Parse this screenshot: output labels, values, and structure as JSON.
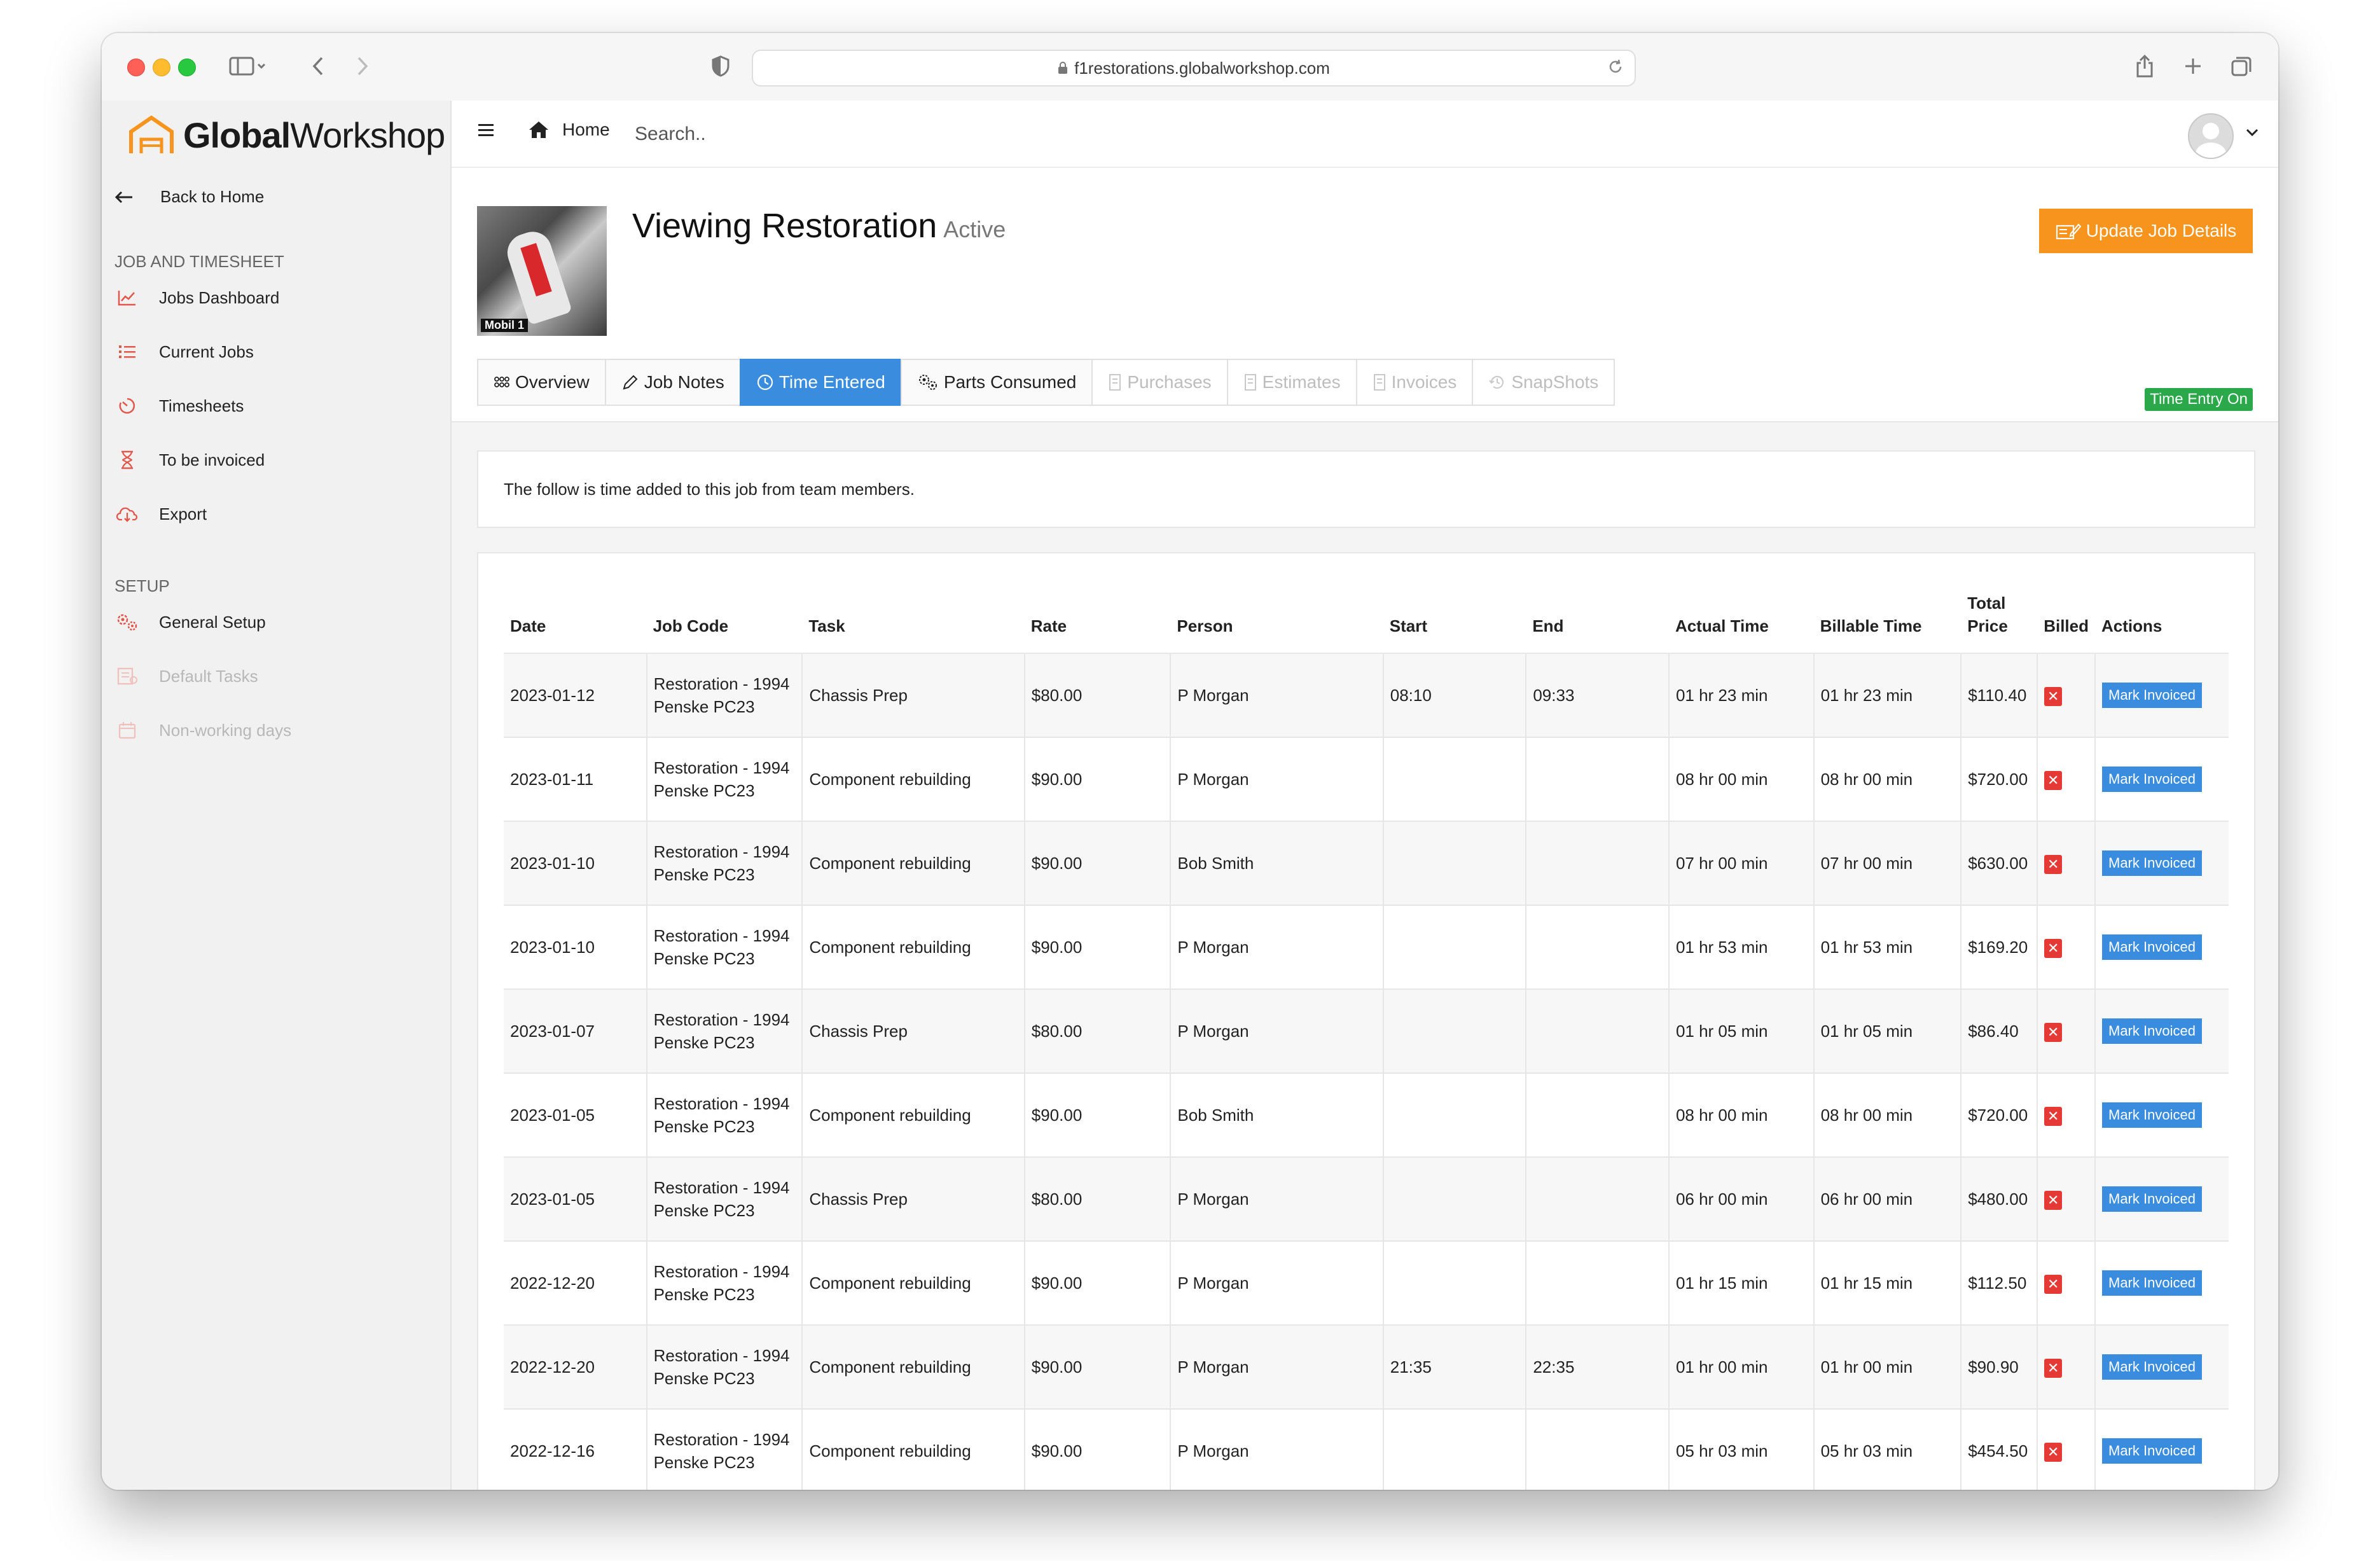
{
  "browser": {
    "url": "f1restorations.globalworkshop.com"
  },
  "brand": {
    "logo_bold": "Global",
    "logo_light": "Workshop",
    "accent_color": "#f7941d"
  },
  "sidebar": {
    "back_label": "Back to Home",
    "section_jobs": "JOB AND TIMESHEET",
    "section_setup": "SETUP",
    "items": [
      {
        "label": "Jobs Dashboard",
        "icon": "chart-icon"
      },
      {
        "label": "Current Jobs",
        "icon": "list-icon"
      },
      {
        "label": "Timesheets",
        "icon": "timer-icon"
      },
      {
        "label": "To be invoiced",
        "icon": "hourglass-icon"
      },
      {
        "label": "Export",
        "icon": "cloud-download-icon"
      }
    ],
    "setup_items": [
      {
        "label": "General Setup",
        "icon": "gears-icon",
        "disabled": false
      },
      {
        "label": "Default Tasks",
        "icon": "tasks-icon",
        "disabled": true
      },
      {
        "label": "Non-working days",
        "icon": "calendar-icon",
        "disabled": true
      }
    ]
  },
  "topbar": {
    "home_label": "Home",
    "search_placeholder": "Search.."
  },
  "job": {
    "title": "Viewing Restoration",
    "status": "Active",
    "update_button": "Update Job Details",
    "time_entry_badge": "Time Entry On",
    "thumb_tag": "Mobil 1"
  },
  "tabs": [
    {
      "label": "Overview",
      "state": "normal"
    },
    {
      "label": "Job Notes",
      "state": "normal"
    },
    {
      "label": "Time Entered",
      "state": "active"
    },
    {
      "label": "Parts Consumed",
      "state": "normal"
    },
    {
      "label": "Purchases",
      "state": "disabled"
    },
    {
      "label": "Estimates",
      "state": "disabled"
    },
    {
      "label": "Invoices",
      "state": "disabled"
    },
    {
      "label": "SnapShots",
      "state": "disabled"
    }
  ],
  "info_text": "The follow is time added to this job from team members.",
  "table": {
    "headers": [
      "Date",
      "Job Code",
      "Task",
      "Rate",
      "Person",
      "Start",
      "End",
      "Actual Time",
      "Billable Time",
      "Total Price",
      "Billed",
      "Actions"
    ],
    "action_label": "Mark Invoiced",
    "billed_symbol": "✕",
    "rows": [
      {
        "date": "2023-01-12",
        "job_code": "Restoration - 1994 Penske PC23",
        "task": "Chassis Prep",
        "rate": "$80.00",
        "person": "P Morgan",
        "start": "08:10",
        "end": "09:33",
        "actual": "01 hr 23 min",
        "billable": "01 hr 23 min",
        "total": "$110.40"
      },
      {
        "date": "2023-01-11",
        "job_code": "Restoration - 1994 Penske PC23",
        "task": "Component rebuilding",
        "rate": "$90.00",
        "person": "P Morgan",
        "start": "",
        "end": "",
        "actual": "08 hr 00 min",
        "billable": "08 hr 00 min",
        "total": "$720.00"
      },
      {
        "date": "2023-01-10",
        "job_code": "Restoration - 1994 Penske PC23",
        "task": "Component rebuilding",
        "rate": "$90.00",
        "person": "Bob Smith",
        "start": "",
        "end": "",
        "actual": "07 hr 00 min",
        "billable": "07 hr 00 min",
        "total": "$630.00"
      },
      {
        "date": "2023-01-10",
        "job_code": "Restoration - 1994 Penske PC23",
        "task": "Component rebuilding",
        "rate": "$90.00",
        "person": "P Morgan",
        "start": "",
        "end": "",
        "actual": "01 hr 53 min",
        "billable": "01 hr 53 min",
        "total": "$169.20"
      },
      {
        "date": "2023-01-07",
        "job_code": "Restoration - 1994 Penske PC23",
        "task": "Chassis Prep",
        "rate": "$80.00",
        "person": "P Morgan",
        "start": "",
        "end": "",
        "actual": "01 hr 05 min",
        "billable": "01 hr 05 min",
        "total": "$86.40"
      },
      {
        "date": "2023-01-05",
        "job_code": "Restoration - 1994 Penske PC23",
        "task": "Component rebuilding",
        "rate": "$90.00",
        "person": "Bob Smith",
        "start": "",
        "end": "",
        "actual": "08 hr 00 min",
        "billable": "08 hr 00 min",
        "total": "$720.00"
      },
      {
        "date": "2023-01-05",
        "job_code": "Restoration - 1994 Penske PC23",
        "task": "Chassis Prep",
        "rate": "$80.00",
        "person": "P Morgan",
        "start": "",
        "end": "",
        "actual": "06 hr 00 min",
        "billable": "06 hr 00 min",
        "total": "$480.00"
      },
      {
        "date": "2022-12-20",
        "job_code": "Restoration - 1994 Penske PC23",
        "task": "Component rebuilding",
        "rate": "$90.00",
        "person": "P Morgan",
        "start": "",
        "end": "",
        "actual": "01 hr 15 min",
        "billable": "01 hr 15 min",
        "total": "$112.50"
      },
      {
        "date": "2022-12-20",
        "job_code": "Restoration - 1994 Penske PC23",
        "task": "Component rebuilding",
        "rate": "$90.00",
        "person": "P Morgan",
        "start": "21:35",
        "end": "22:35",
        "actual": "01 hr 00 min",
        "billable": "01 hr 00 min",
        "total": "$90.90"
      },
      {
        "date": "2022-12-16",
        "job_code": "Restoration - 1994 Penske PC23",
        "task": "Component rebuilding",
        "rate": "$90.00",
        "person": "P Morgan",
        "start": "",
        "end": "",
        "actual": "05 hr 03 min",
        "billable": "05 hr 03 min",
        "total": "$454.50"
      }
    ]
  }
}
